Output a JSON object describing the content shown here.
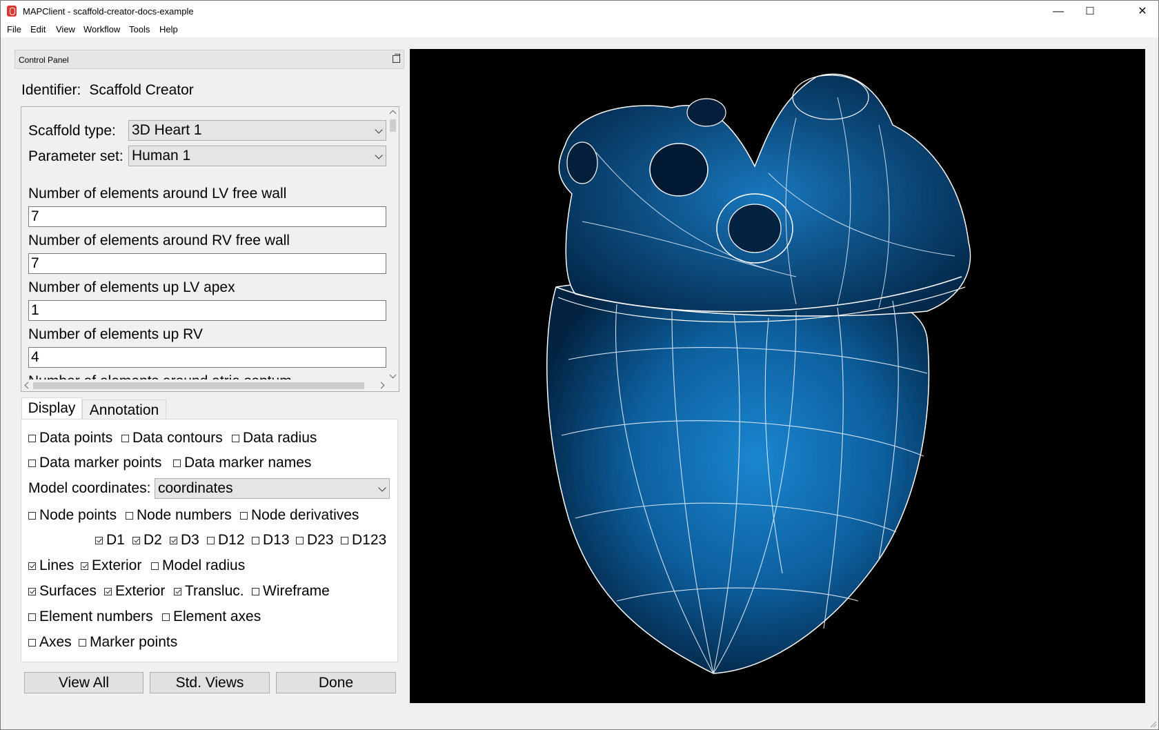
{
  "window": {
    "title": "MAPClient - scaffold-creator-docs-example",
    "minimize": "—",
    "maximize": "☐",
    "close": "✕"
  },
  "menu": [
    "File",
    "Edit",
    "View",
    "Workflow",
    "Tools",
    "Help"
  ],
  "control_panel": {
    "title": "Control Panel",
    "identifier_label": "Identifier:",
    "identifier_value": "Scaffold Creator",
    "scaffold_type_label": "Scaffold type:",
    "scaffold_type_value": "3D Heart 1",
    "parameter_set_label": "Parameter set:",
    "parameter_set_value": "Human 1",
    "params": [
      {
        "label": "Number of elements around LV free wall",
        "value": "7"
      },
      {
        "label": "Number of elements around RV free wall",
        "value": "7"
      },
      {
        "label": "Number of elements up LV apex",
        "value": "1"
      },
      {
        "label": "Number of elements up RV",
        "value": "4"
      },
      {
        "label": "Number of elements around atria septum",
        "value": ""
      }
    ]
  },
  "tabs": {
    "display": "Display",
    "annotation": "Annotation"
  },
  "display": {
    "data_points": {
      "label": "Data points",
      "checked": false
    },
    "data_contours": {
      "label": "Data contours",
      "checked": false
    },
    "data_radius": {
      "label": "Data radius",
      "checked": false
    },
    "data_marker_points": {
      "label": "Data marker points",
      "checked": false
    },
    "data_marker_names": {
      "label": "Data marker names",
      "checked": false
    },
    "model_coordinates_label": "Model coordinates:",
    "model_coordinates_value": "coordinates",
    "node_points": {
      "label": "Node points",
      "checked": false
    },
    "node_numbers": {
      "label": "Node numbers",
      "checked": false
    },
    "node_derivatives": {
      "label": "Node derivatives",
      "checked": false
    },
    "d1": {
      "label": "D1",
      "checked": true
    },
    "d2": {
      "label": "D2",
      "checked": true
    },
    "d3": {
      "label": "D3",
      "checked": true
    },
    "d12": {
      "label": "D12",
      "checked": false
    },
    "d13": {
      "label": "D13",
      "checked": false
    },
    "d23": {
      "label": "D23",
      "checked": false
    },
    "d123": {
      "label": "D123",
      "checked": false
    },
    "lines": {
      "label": "Lines",
      "checked": true
    },
    "lines_exterior": {
      "label": "Exterior",
      "checked": true
    },
    "model_radius": {
      "label": "Model radius",
      "checked": false
    },
    "surfaces": {
      "label": "Surfaces",
      "checked": true
    },
    "surfaces_exterior": {
      "label": "Exterior",
      "checked": true
    },
    "transluc": {
      "label": "Transluc.",
      "checked": true
    },
    "wireframe": {
      "label": "Wireframe",
      "checked": false
    },
    "element_numbers": {
      "label": "Element numbers",
      "checked": false
    },
    "element_axes": {
      "label": "Element axes",
      "checked": false
    },
    "axes": {
      "label": "Axes",
      "checked": false
    },
    "marker_points": {
      "label": "Marker points",
      "checked": false
    }
  },
  "buttons": {
    "view_all": "View All",
    "std_views": "Std. Views",
    "done": "Done"
  },
  "colors": {
    "heart": "#0d5f9e",
    "wire": "#ffffff",
    "viewport_bg": "#000000"
  }
}
